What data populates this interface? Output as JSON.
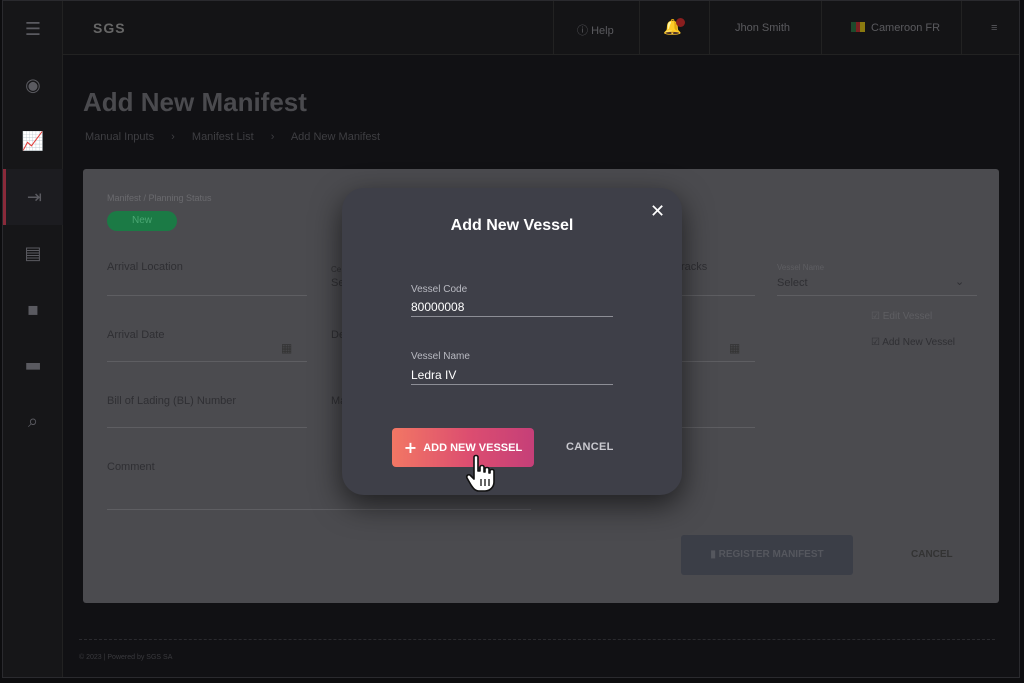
{
  "topbar": {
    "logo": "SGS",
    "help": "Help",
    "user": "Jhon Smith",
    "country": "Cameroon FR"
  },
  "page": {
    "title": "Add New Manifest",
    "breadcrumb": [
      "Manual Inputs",
      "Manifest List",
      "Add New Manifest"
    ]
  },
  "form": {
    "status_label": "Manifest / Planning Status",
    "status_value": "New",
    "arrival_location": "Arrival Location",
    "arrival_date": "Arrival Date",
    "bl_number": "Bill of Lading (BL) Number",
    "comment": "Comment",
    "col2_a": "Se",
    "col2_a_label": "Ce",
    "col2_b": "De",
    "col2_c": "Ma",
    "col3_a": "racks",
    "vessel_name_label": "Vessel Name",
    "vessel_select": "Select",
    "edit_vessel": "Edit Vessel",
    "add_new_vessel": "Add New Vessel",
    "register_button": "REGISTER MANIFEST",
    "cancel_button": "CANCEL"
  },
  "footer": {
    "text": "© 2023 | Powered by SGS SA"
  },
  "modal": {
    "title": "Add New Vessel",
    "vessel_code_label": "Vessel Code",
    "vessel_code_value": "80000008",
    "vessel_name_label": "Vessel Name",
    "vessel_name_value": "Ledra IV",
    "add_button": "ADD NEW VESSEL",
    "cancel_button": "CANCEL"
  },
  "colors": {
    "accent_start": "#f27764",
    "accent_end": "#c53f78",
    "modal_bg": "#3e3f48",
    "status_badge": "#1b7a45"
  }
}
